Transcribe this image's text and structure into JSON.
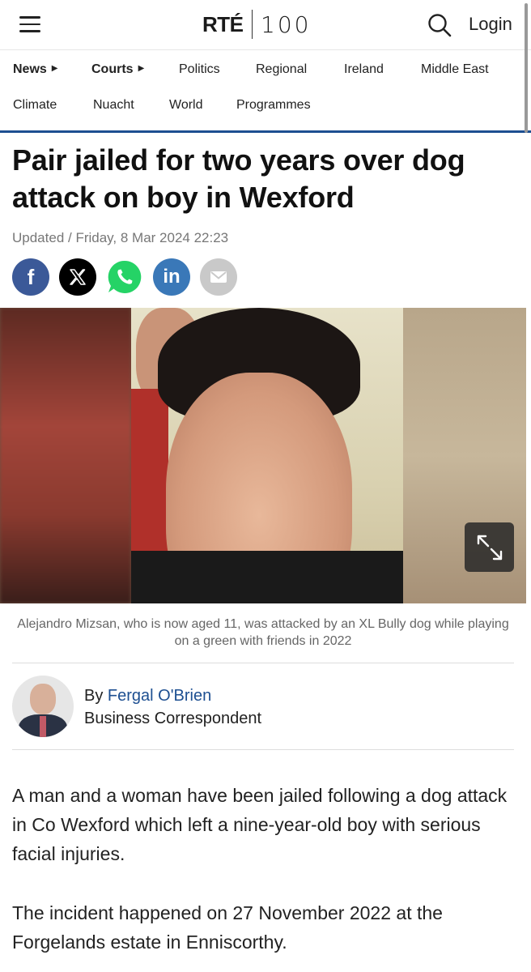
{
  "header": {
    "logo_rte": "RTÉ",
    "logo_100": "100",
    "login_label": "Login"
  },
  "nav": {
    "items": [
      {
        "label": "News",
        "has_caret": true
      },
      {
        "label": "Courts",
        "has_caret": true
      },
      {
        "label": "Politics"
      },
      {
        "label": "Regional"
      },
      {
        "label": "Ireland"
      },
      {
        "label": "Middle East"
      },
      {
        "label": "Climate"
      },
      {
        "label": "Nuacht"
      },
      {
        "label": "World"
      },
      {
        "label": "Programmes"
      }
    ]
  },
  "article": {
    "headline": "Pair jailed for two years over dog attack on boy in Wexford",
    "updated": "Updated / Friday, 8 Mar 2024 22:23",
    "caption": "Alejandro Mizsan, who is now aged 11, was attacked by an XL Bully dog while playing on a green with friends in 2022",
    "author": {
      "by": "By",
      "name": "Fergal O'Brien",
      "role": "Business Correspondent"
    },
    "paragraphs": [
      "A man and a woman have been jailed following a dog attack in Co Wexford which left a nine-year-old boy with serious facial injuries.",
      "The incident happened on 27 November 2022 at the Forgelands estate in Enniscorthy."
    ]
  },
  "share": {
    "icons": [
      "facebook-icon",
      "x-icon",
      "whatsapp-icon",
      "linkedin-icon",
      "email-icon"
    ],
    "facebook_glyph": "f",
    "linkedin_glyph": "in"
  },
  "colors": {
    "accent": "#1d4f91",
    "facebook": "#3b5998",
    "whatsapp": "#25d366",
    "linkedin": "#3a78b8"
  }
}
